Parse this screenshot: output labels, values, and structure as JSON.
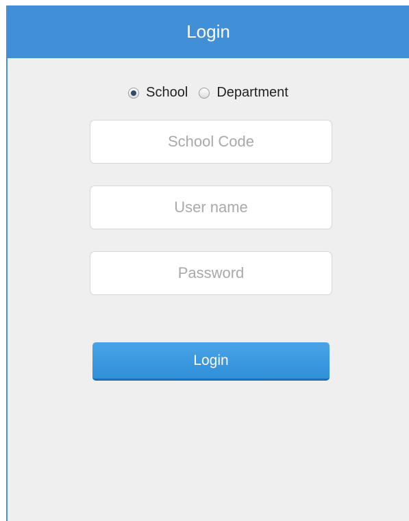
{
  "header": {
    "title": "Login"
  },
  "login_type": {
    "options": [
      {
        "label": "School",
        "selected": true
      },
      {
        "label": "Department",
        "selected": false
      }
    ]
  },
  "form": {
    "school_code_placeholder": "School Code",
    "username_placeholder": "User name",
    "password_placeholder": "Password",
    "submit_label": "Login"
  },
  "colors": {
    "header_bg": "#418fd6",
    "button_bg": "#2f8fd8",
    "panel_bg": "#efefef"
  }
}
